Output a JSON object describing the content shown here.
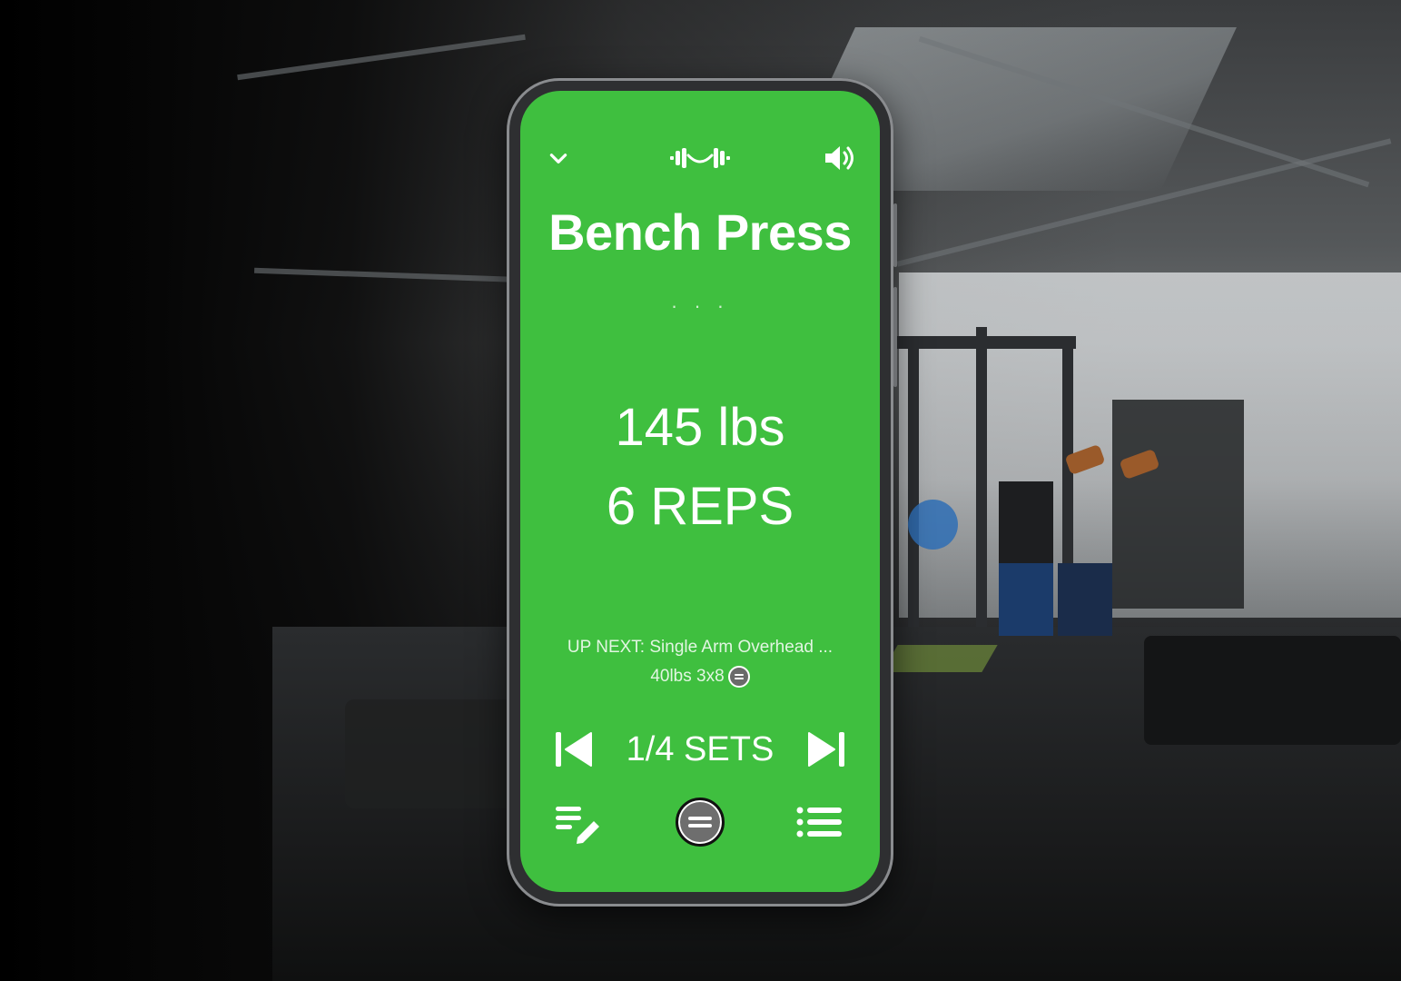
{
  "exercise": {
    "title": "Bench Press",
    "dots": "· · ·",
    "weight": "145 lbs",
    "reps": "6 REPS"
  },
  "up_next": {
    "text": "UP NEXT: Single Arm Overhead ...",
    "detail": "40lbs 3x8"
  },
  "sets": {
    "label": "1/4 SETS"
  },
  "icons": {
    "collapse": "chevron-down-icon",
    "logo": "barbell-logo-icon",
    "sound": "volume-icon",
    "previous": "skip-previous-icon",
    "next": "skip-next-icon",
    "notes": "edit-notes-icon",
    "complete": "complete-set-icon",
    "list": "workout-list-icon"
  },
  "colors": {
    "screen_background": "#3fbf3f",
    "text": "#ffffff",
    "complete_button": "#6e6e6e"
  }
}
